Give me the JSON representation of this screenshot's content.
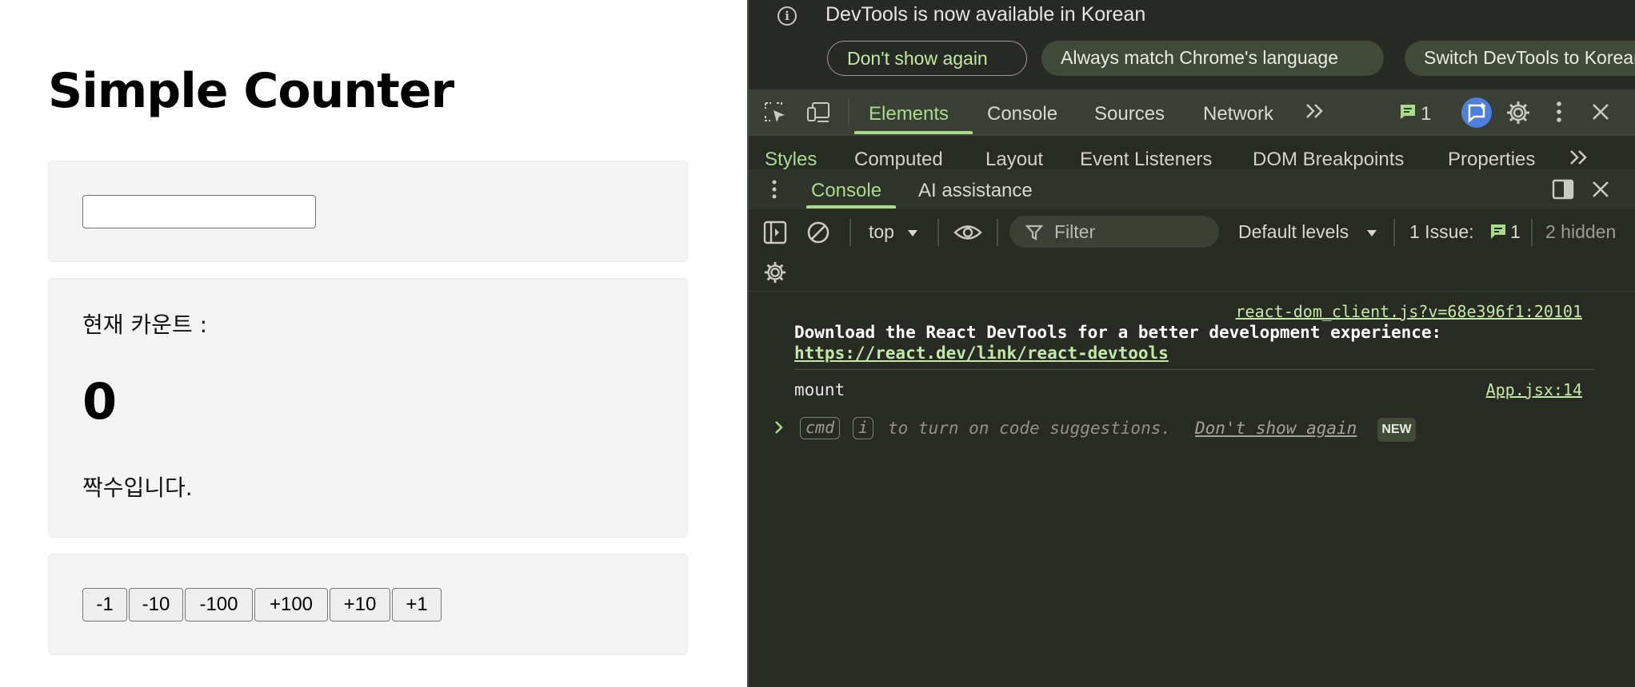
{
  "app": {
    "title": "Simple Counter",
    "input": {
      "value": "",
      "placeholder": ""
    },
    "viewer": {
      "label": "현재 카운트 :",
      "count": "0",
      "parity": "짝수입니다."
    },
    "controller": {
      "buttons": [
        "-1",
        "-10",
        "-100",
        "+100",
        "+10",
        "+1"
      ]
    }
  },
  "devtools": {
    "infobar": {
      "message": "DevTools is now available in Korean",
      "dont_show": "Don't show again",
      "match_language": "Always match Chrome's language",
      "switch_language": "Switch DevTools to Korean"
    },
    "main_tabs": [
      "Elements",
      "Console",
      "Sources",
      "Network"
    ],
    "active_main_tab": "Elements",
    "issues_badge": "1",
    "sub_tabs": [
      "Styles",
      "Computed",
      "Layout",
      "Event Listeners",
      "DOM Breakpoints",
      "Properties"
    ],
    "drawer_tabs": [
      "Console",
      "AI assistance"
    ],
    "console_toolbar": {
      "context": "top",
      "filter_placeholder": "Filter",
      "levels": "Default levels",
      "issues_label": "1 Issue:",
      "issues_count": "1",
      "hidden": "2 hidden"
    },
    "logs": [
      {
        "source": "react-dom_client.js?v=68e396f1:20101",
        "message": "Download the React DevTools for a better development experience:",
        "link": "https://react.dev/link/react-devtools"
      },
      {
        "source": "App.jsx:14",
        "message": "mount"
      }
    ],
    "prompt_hint": {
      "key1": "cmd",
      "key2": "i",
      "text": "to turn on code suggestions.",
      "dismiss": "Don't show again",
      "badge": "NEW"
    }
  },
  "colors": {
    "devtools_bg": "#282a24",
    "accent_green": "#a8dc8a",
    "card_bg": "#f4f4f4",
    "ai_button_blue": "#4e7fe0"
  }
}
